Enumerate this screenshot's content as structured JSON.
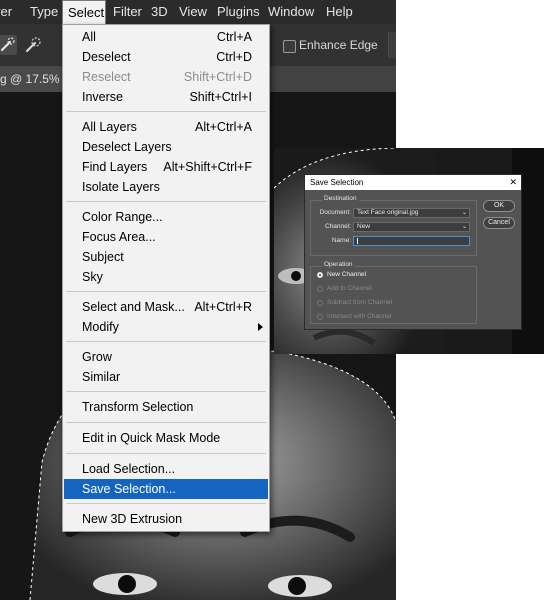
{
  "menubar": {
    "items": [
      {
        "label": "yer"
      },
      {
        "label": "Type"
      },
      {
        "label": "Select"
      },
      {
        "label": "Filter"
      },
      {
        "label": "3D"
      },
      {
        "label": "View"
      },
      {
        "label": "Plugins"
      },
      {
        "label": "Window"
      },
      {
        "label": "Help"
      }
    ],
    "active_label": "Select"
  },
  "options_bar": {
    "enhance_edge_label": "Enhance Edge",
    "enhance_edge_checked": false,
    "tool_icons": [
      "quick-selection-icon",
      "quick-selection-brush-icon"
    ]
  },
  "document_tab": {
    "label": "g @ 17.5%"
  },
  "select_menu": {
    "items": [
      {
        "label": "All",
        "shortcut": "Ctrl+A"
      },
      {
        "label": "Deselect",
        "shortcut": "Ctrl+D"
      },
      {
        "label": "Reselect",
        "shortcut": "Shift+Ctrl+D",
        "disabled": true
      },
      {
        "label": "Inverse",
        "shortcut": "Shift+Ctrl+I"
      },
      {
        "label": "All Layers",
        "shortcut": "Alt+Ctrl+A"
      },
      {
        "label": "Deselect Layers",
        "shortcut": ""
      },
      {
        "label": "Find Layers",
        "shortcut": "Alt+Shift+Ctrl+F"
      },
      {
        "label": "Isolate Layers",
        "shortcut": ""
      },
      {
        "label": "Color Range...",
        "shortcut": ""
      },
      {
        "label": "Focus Area...",
        "shortcut": ""
      },
      {
        "label": "Subject",
        "shortcut": ""
      },
      {
        "label": "Sky",
        "shortcut": ""
      },
      {
        "label": "Select and Mask...",
        "shortcut": "Alt+Ctrl+R"
      },
      {
        "label": "Modify",
        "shortcut": "",
        "submenu": true
      },
      {
        "label": "Grow",
        "shortcut": ""
      },
      {
        "label": "Similar",
        "shortcut": ""
      },
      {
        "label": "Transform Selection",
        "shortcut": ""
      },
      {
        "label": "Edit in Quick Mask Mode",
        "shortcut": ""
      },
      {
        "label": "Load Selection...",
        "shortcut": ""
      },
      {
        "label": "Save Selection...",
        "shortcut": "",
        "selected": true
      },
      {
        "label": "New 3D Extrusion",
        "shortcut": ""
      }
    ],
    "highlight_color": "#1565c0"
  },
  "save_selection_dialog": {
    "title": "Save Selection",
    "close_glyph": "✕",
    "destination": {
      "title": "Destination",
      "document_label": "Document:",
      "document_value": "Text Face original.jpg",
      "channel_label": "Channel:",
      "channel_value": "New",
      "name_label": "Name:",
      "name_value": ""
    },
    "operation": {
      "title": "Operation",
      "options": [
        {
          "label": "New Channel",
          "selected": true,
          "enabled": true
        },
        {
          "label": "Add to Channel",
          "selected": false,
          "enabled": false
        },
        {
          "label": "Subtract from Channel",
          "selected": false,
          "enabled": false
        },
        {
          "label": "Intersect with Channel",
          "selected": false,
          "enabled": false
        }
      ]
    },
    "ok_label": "OK",
    "cancel_label": "Cancel"
  }
}
